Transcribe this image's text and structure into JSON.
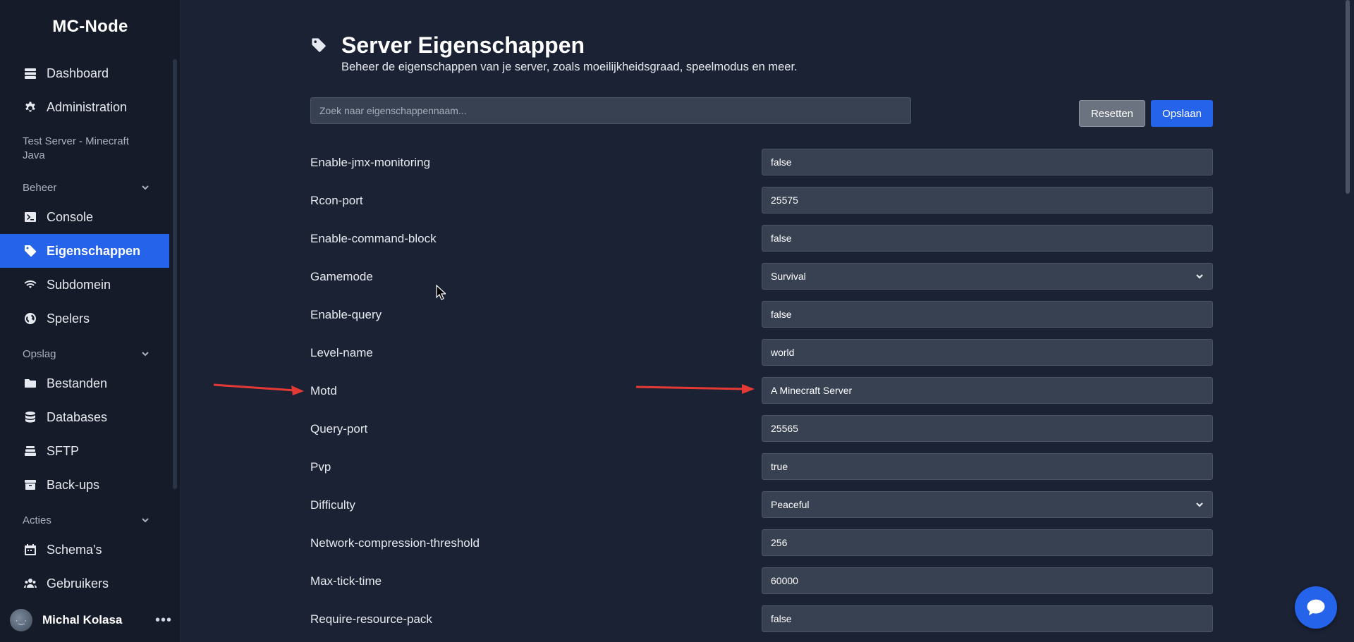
{
  "brand": "MC-Node",
  "sidebar": {
    "top_items": [
      {
        "label": "Dashboard",
        "icon": "server-stack-icon"
      },
      {
        "label": "Administration",
        "icon": "gear-icon"
      }
    ],
    "server_name": "Test Server - Minecraft Java",
    "sections": [
      {
        "title": "Beheer",
        "items": [
          {
            "label": "Console",
            "icon": "terminal-icon"
          },
          {
            "label": "Eigenschappen",
            "icon": "tag-icon",
            "active": true
          },
          {
            "label": "Subdomein",
            "icon": "wifi-icon"
          },
          {
            "label": "Spelers",
            "icon": "globe-icon"
          }
        ]
      },
      {
        "title": "Opslag",
        "items": [
          {
            "label": "Bestanden",
            "icon": "folder-icon"
          },
          {
            "label": "Databases",
            "icon": "database-icon"
          },
          {
            "label": "SFTP",
            "icon": "layers-icon"
          },
          {
            "label": "Back-ups",
            "icon": "archive-icon"
          }
        ]
      },
      {
        "title": "Acties",
        "items": [
          {
            "label": "Schema's",
            "icon": "calendar-icon"
          },
          {
            "label": "Gebruikers",
            "icon": "users-icon"
          }
        ]
      }
    ],
    "user": {
      "name": "Michal Kolasa",
      "more": "•••"
    }
  },
  "page": {
    "title": "Server Eigenschappen",
    "subtitle": "Beheer de eigenschappen van je server, zoals moeilijkheidsgraad, speelmodus en meer.",
    "search_placeholder": "Zoek naar eigenschappennaam...",
    "reset_label": "Resetten",
    "save_label": "Opslaan"
  },
  "properties": [
    {
      "label": "Enable-jmx-monitoring",
      "value": "false",
      "type": "text"
    },
    {
      "label": "Rcon-port",
      "value": "25575",
      "type": "text"
    },
    {
      "label": "Enable-command-block",
      "value": "false",
      "type": "text"
    },
    {
      "label": "Gamemode",
      "value": "Survival",
      "type": "select"
    },
    {
      "label": "Enable-query",
      "value": "false",
      "type": "text"
    },
    {
      "label": "Level-name",
      "value": "world",
      "type": "text"
    },
    {
      "label": "Motd",
      "value": "A Minecraft Server",
      "type": "text"
    },
    {
      "label": "Query-port",
      "value": "25565",
      "type": "text"
    },
    {
      "label": "Pvp",
      "value": "true",
      "type": "text"
    },
    {
      "label": "Difficulty",
      "value": "Peaceful",
      "type": "select"
    },
    {
      "label": "Network-compression-threshold",
      "value": "256",
      "type": "text"
    },
    {
      "label": "Max-tick-time",
      "value": "60000",
      "type": "text"
    },
    {
      "label": "Require-resource-pack",
      "value": "false",
      "type": "text"
    }
  ],
  "colors": {
    "accent": "#2563eb",
    "annotation_arrow": "#e53935"
  }
}
